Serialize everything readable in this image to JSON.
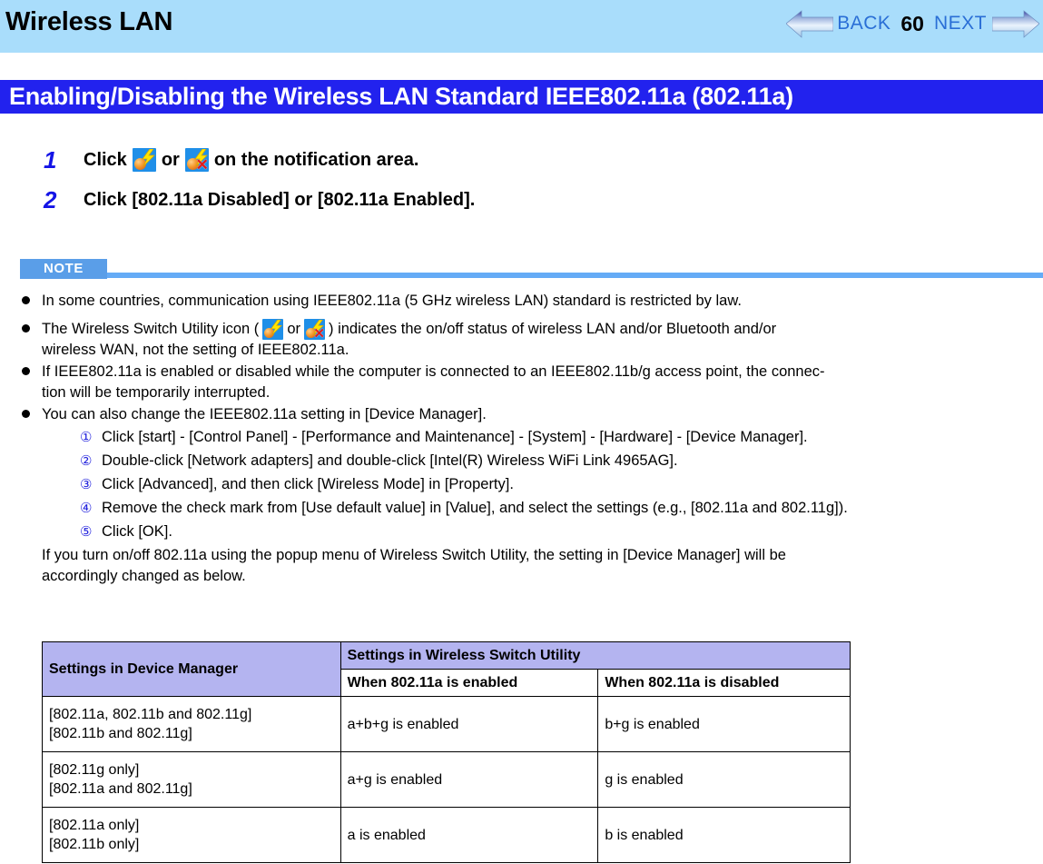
{
  "header": {
    "title": "Wireless LAN",
    "nav": {
      "back_label": "BACK",
      "page_number": "60",
      "next_label": "NEXT",
      "back_arrow_icon": "arrow-left-icon",
      "next_arrow_icon": "arrow-right-icon"
    },
    "bg_color": "#a9ddfb",
    "nav_text_color": "#2a6fd6"
  },
  "section": {
    "title": "Enabling/Disabling the Wireless LAN Standard IEEE802.11a (802.11a)",
    "band_color": "#2222ee",
    "text_color": "#ffffff"
  },
  "steps": [
    {
      "number": "1",
      "text_before": "Click",
      "icon_on": "wireless-switch-on-icon",
      "separator": "or",
      "icon_off": "wireless-switch-off-icon",
      "text_after": "on the notification area."
    },
    {
      "number": "2",
      "text_full": "Click [802.11a Disabled] or [802.11a Enabled]."
    }
  ],
  "note": {
    "badge_label": "NOTE",
    "badge_color": "#5a9ee8",
    "rule_color": "#65abf6",
    "bullets": [
      {
        "text": "In some countries, communication using IEEE802.11a (5 GHz wireless LAN) standard is restricted by law."
      },
      {
        "has_icons": true,
        "text_before": "The Wireless Switch Utility icon (",
        "separator": "or",
        "text_after": ") indicates the on/off status of wireless LAN and/or Bluetooth and/or",
        "text_line2": "wireless WAN, not the setting of IEEE802.11a."
      },
      {
        "text": "If IEEE802.11a is enabled or disabled while the computer is connected to an IEEE802.11b/g access point, the connec-",
        "text_line2": "tion will be temporarily interrupted."
      },
      {
        "text": "You can also change the IEEE802.11a setting in [Device Manager]."
      }
    ],
    "substeps": [
      {
        "marker": "①",
        "text": "Click [start] - [Control Panel] - [Performance and Maintenance] - [System] - [Hardware] - [Device Manager]."
      },
      {
        "marker": "②",
        "text": "Double-click [Network adapters] and double-click [Intel(R) Wireless WiFi Link 4965AG]."
      },
      {
        "marker": "③",
        "text": "Click [Advanced], and then click [Wireless Mode] in [Property]."
      },
      {
        "marker": "④",
        "text": "Remove the check mark from [Use default value] in [Value], and select the settings (e.g., [802.11a and 802.11g])."
      },
      {
        "marker": "⑤",
        "text": "Click [OK]."
      }
    ],
    "closing_paragraph_line1": "If you turn on/off 802.11a using the popup menu of Wireless Switch Utility, the setting in [Device Manager] will be",
    "closing_paragraph_line2": "accordingly changed as below."
  },
  "table": {
    "header_bg": "#b4b4f0",
    "col1_header": "Settings in Device Manager",
    "col_group_header": "Settings in Wireless Switch Utility",
    "col2_subheader": "When 802.11a is enabled",
    "col3_subheader": "When 802.11a is disabled",
    "rows": [
      {
        "device_manager_line1": "[802.11a, 802.11b and 802.11g]",
        "device_manager_line2": "[802.11b and 802.11g]",
        "enabled": "a+b+g is enabled",
        "disabled": "b+g is enabled"
      },
      {
        "device_manager_line1": "[802.11g only]",
        "device_manager_line2": "[802.11a and 802.11g]",
        "enabled": "a+g is enabled",
        "disabled": "g is enabled"
      },
      {
        "device_manager_line1": "[802.11a only]",
        "device_manager_line2": "[802.11b only]",
        "enabled": "a is enabled",
        "disabled": "b is enabled"
      }
    ]
  }
}
